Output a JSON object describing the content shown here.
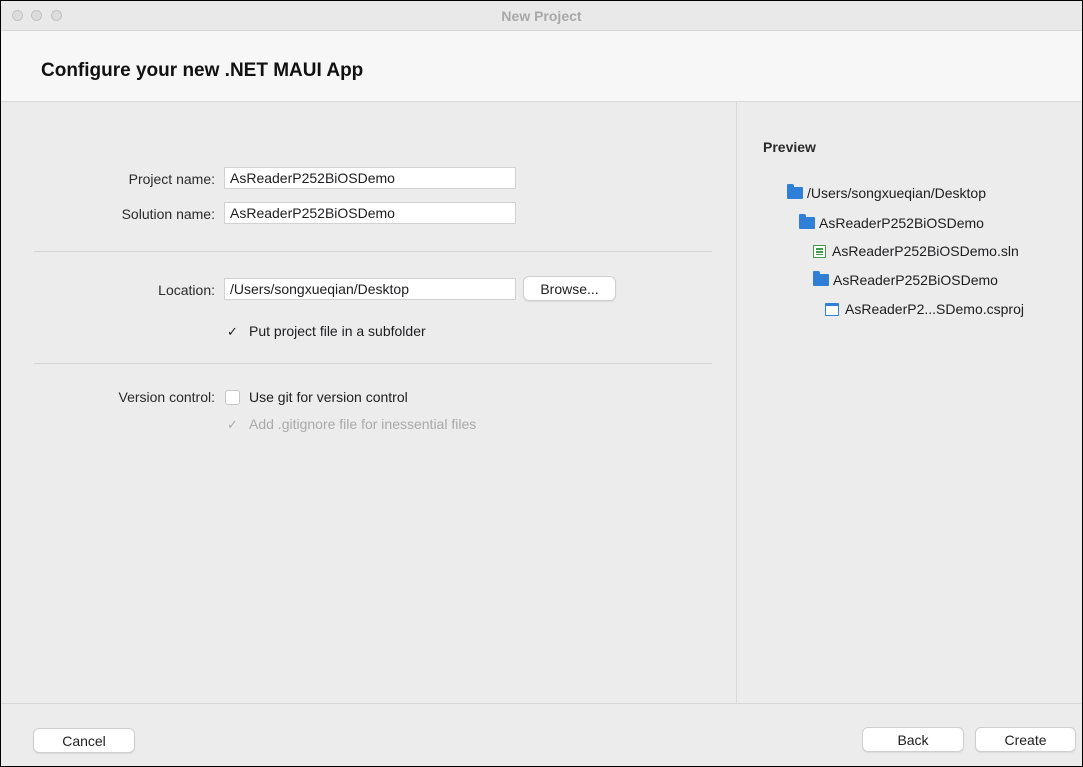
{
  "window": {
    "title": "New Project"
  },
  "header": {
    "title": "Configure your new .NET MAUI App"
  },
  "form": {
    "project_name_label": "Project name:",
    "project_name_value": "AsReaderP252BiOSDemo",
    "solution_name_label": "Solution name:",
    "solution_name_value": "AsReaderP252BiOSDemo",
    "location_label": "Location:",
    "location_value": "/Users/songxueqian/Desktop",
    "browse_label": "Browse...",
    "subfolder_label": "Put project file in a subfolder",
    "subfolder_checked": true,
    "version_control_label": "Version control:",
    "git_label": "Use git for version control",
    "git_checked": false,
    "gitignore_label": "Add .gitignore file for inessential files",
    "gitignore_checked": true,
    "gitignore_disabled": true
  },
  "preview": {
    "title": "Preview",
    "items": [
      {
        "label": "/Users/songxueqian/Desktop",
        "icon": "folder-icon"
      },
      {
        "label": "AsReaderP252BiOSDemo",
        "icon": "folder-icon"
      },
      {
        "label": "AsReaderP252BiOSDemo.sln",
        "icon": "solution-file-icon"
      },
      {
        "label": "AsReaderP252BiOSDemo",
        "icon": "folder-icon"
      },
      {
        "label": "AsReaderP2...SDemo.csproj",
        "icon": "project-file-icon"
      }
    ]
  },
  "footer": {
    "cancel_label": "Cancel",
    "back_label": "Back",
    "create_label": "Create"
  },
  "colors": {
    "accent": "#2f7fd6",
    "solution_icon": "#3f9a4a",
    "window_bg": "#ececec"
  }
}
